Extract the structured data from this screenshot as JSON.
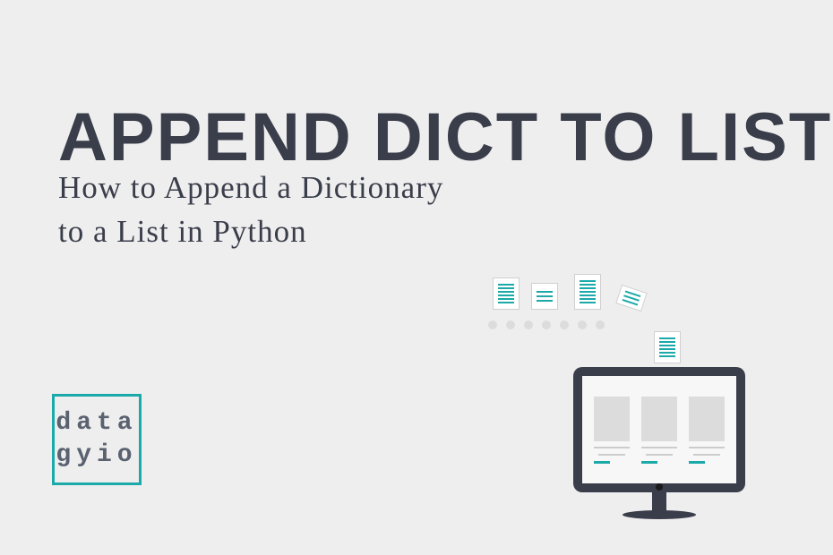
{
  "header": {
    "title": "APPEND DICT TO LIST",
    "subtitle_line1": "How to Append a Dictionary",
    "subtitle_line2": "to a List in Python"
  },
  "logo": {
    "line1": "data",
    "line2": "gyio"
  }
}
